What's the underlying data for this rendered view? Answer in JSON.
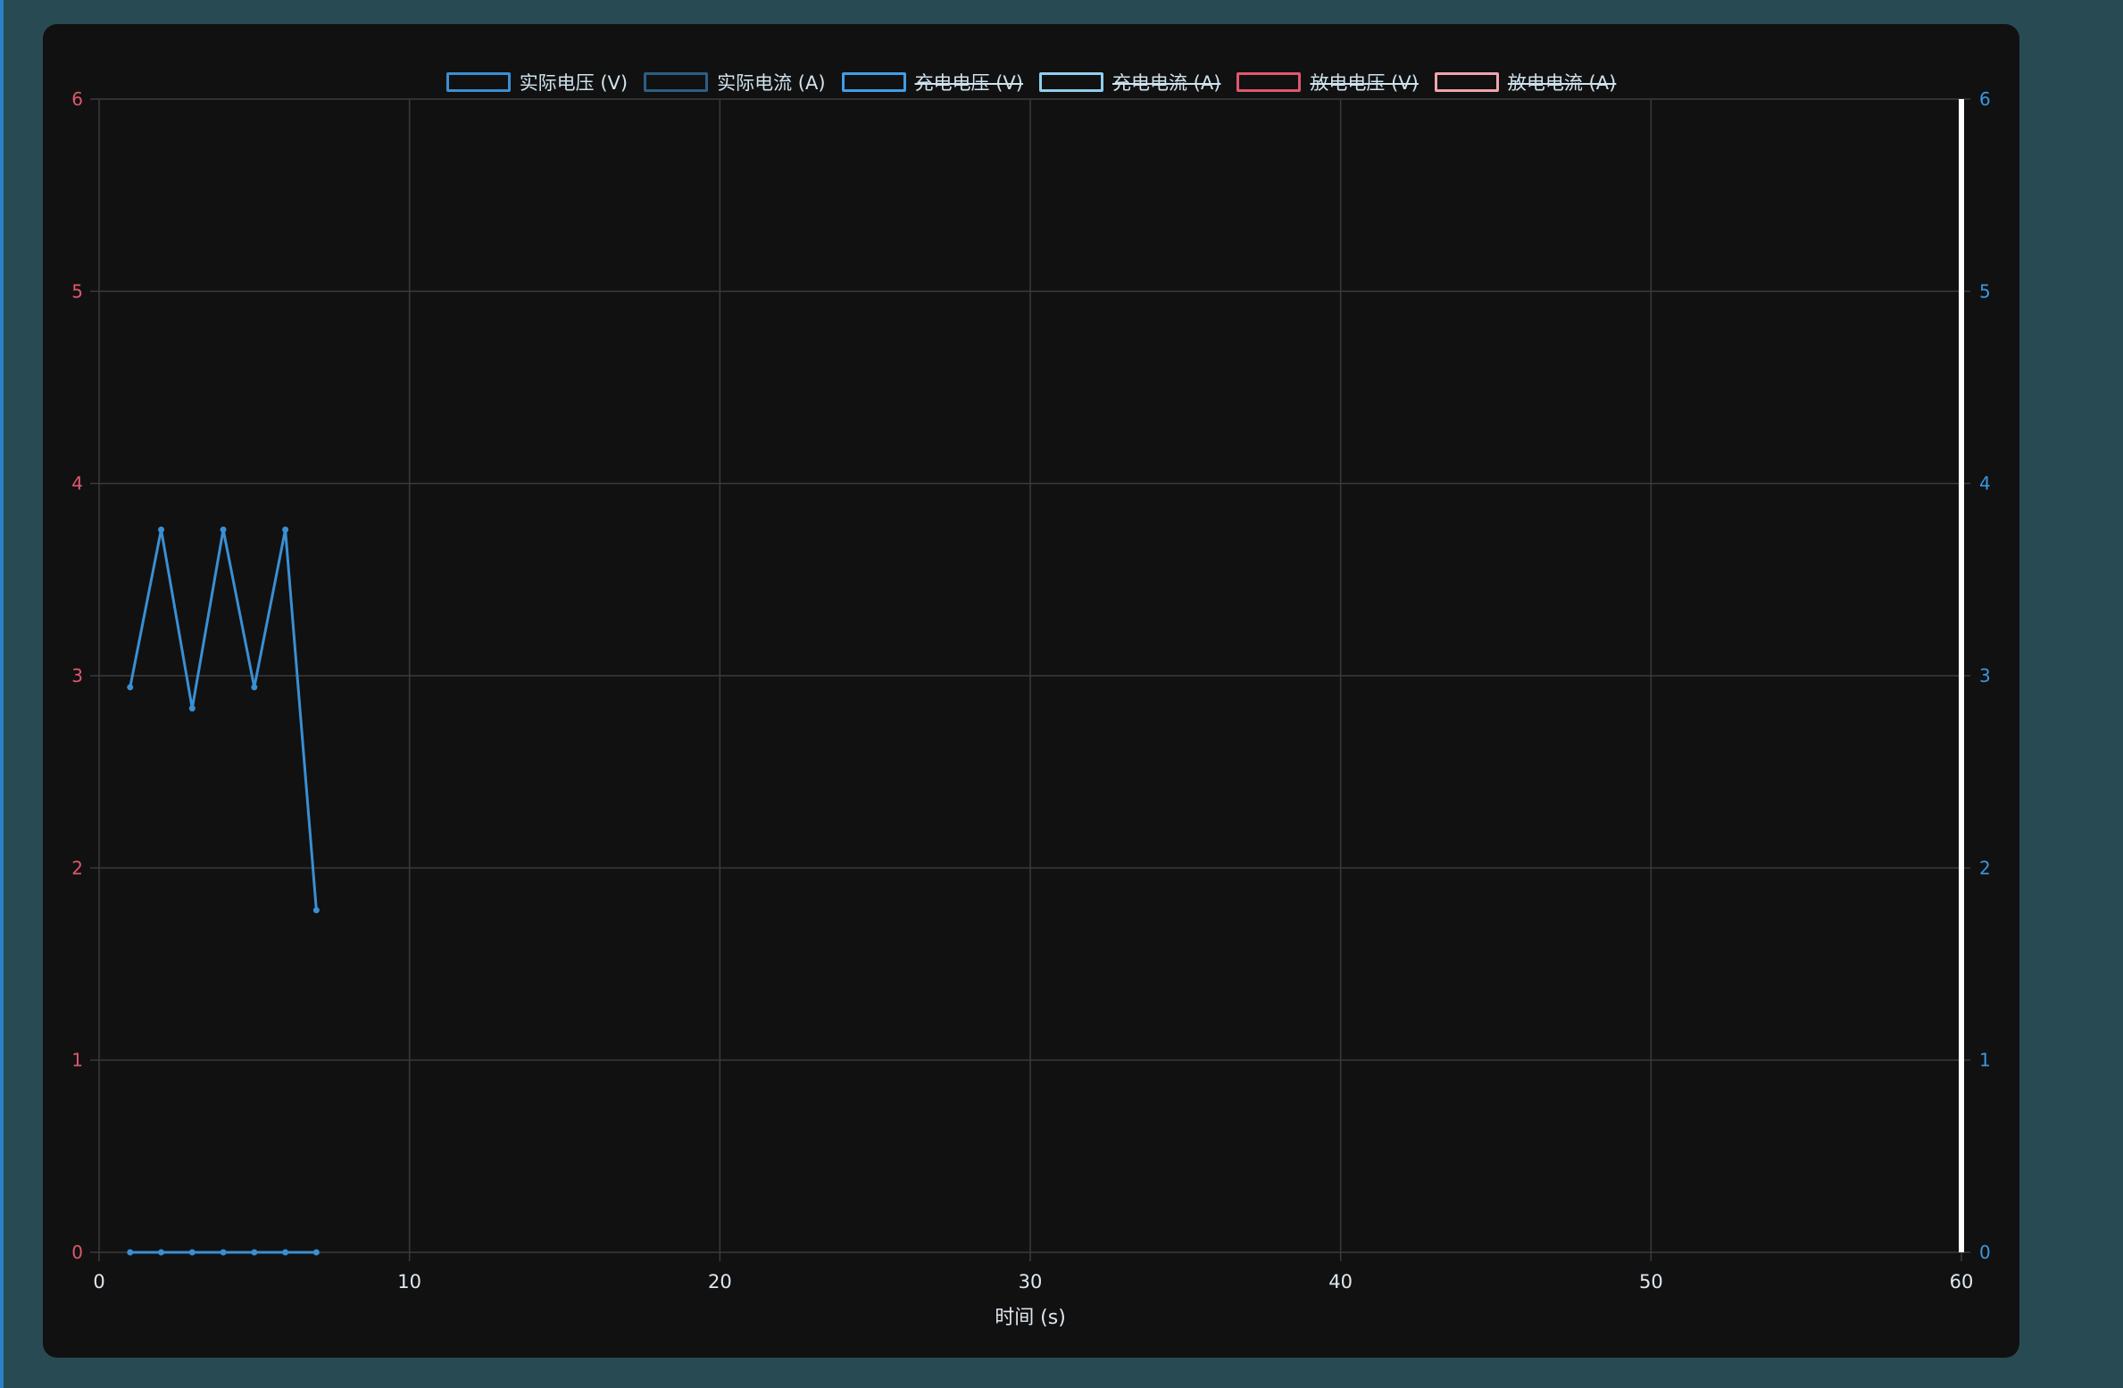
{
  "colors": {
    "page_background": "#284a53",
    "card_background": "#111111",
    "grid": "#3a3a3a",
    "left_axis_ticks": "#e0576e",
    "right_axis_ticks": "#3a97e0",
    "x_axis_ticks": "#dfe7ef",
    "series_line": "#3a8fd3"
  },
  "legend": [
    {
      "label": "实际电压 (V)",
      "color": "#3a8fd3",
      "hidden": false
    },
    {
      "label": "实际电流 (A)",
      "color": "#2a5f86",
      "hidden": false
    },
    {
      "label": "充电电压 (V)",
      "color": "#3f9ee8",
      "hidden": true
    },
    {
      "label": "充电电流 (A)",
      "color": "#8ecfee",
      "hidden": true
    },
    {
      "label": "放电电压 (V)",
      "color": "#e0576e",
      "hidden": true
    },
    {
      "label": "放电电流 (A)",
      "color": "#f1a3ae",
      "hidden": true
    }
  ],
  "chart_data": {
    "type": "line",
    "xlabel": "时间 (s)",
    "xlim": [
      0,
      60
    ],
    "x_ticks": [
      0,
      10,
      20,
      30,
      40,
      50,
      60
    ],
    "y_left_lim": [
      0,
      6
    ],
    "y_left_ticks": [
      0,
      1,
      2,
      3,
      4,
      5,
      6
    ],
    "y_right_lim": [
      0,
      6
    ],
    "y_right_ticks": [
      0,
      1,
      2,
      3,
      4,
      5,
      6
    ],
    "grid": true,
    "legend_position": "top-center",
    "series": [
      {
        "name": "实际电压 (V)",
        "axis": "left",
        "x": [
          1,
          2,
          3,
          4,
          5,
          6,
          7
        ],
        "values": [
          2.94,
          3.76,
          2.83,
          3.76,
          2.94,
          3.76,
          1.78
        ]
      },
      {
        "name": "实际电流 (A)",
        "axis": "right",
        "x": [
          1,
          2,
          3,
          4,
          5,
          6,
          7
        ],
        "values": [
          0,
          0,
          0,
          0,
          0,
          0,
          0
        ]
      }
    ]
  }
}
